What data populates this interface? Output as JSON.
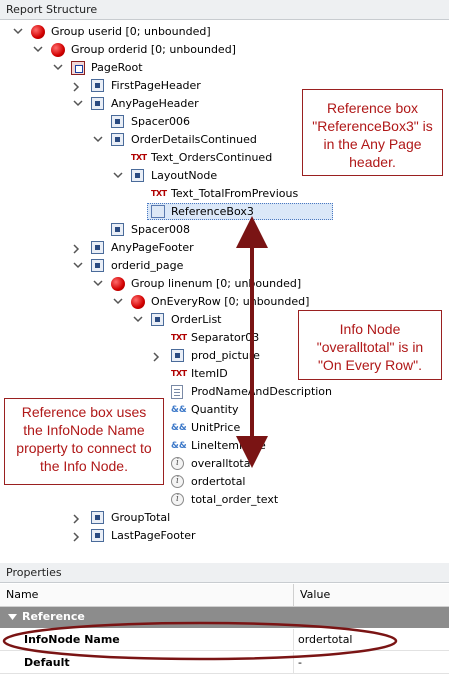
{
  "report_structure": {
    "title": "Report Structure",
    "nodes": [
      {
        "label": "Group userid [0; unbounded]",
        "icon": "group-icon",
        "expander": "expanded"
      },
      {
        "label": "Group orderid [0; unbounded]",
        "icon": "group-icon",
        "expander": "expanded"
      },
      {
        "label": "PageRoot",
        "icon": "page-root-icon",
        "expander": "expanded"
      },
      {
        "label": "FirstPageHeader",
        "icon": "container-icon",
        "expander": "collapsed"
      },
      {
        "label": "AnyPageHeader",
        "icon": "container-icon",
        "expander": "expanded"
      },
      {
        "label": "Spacer006",
        "icon": "spacer-icon",
        "expander": "none"
      },
      {
        "label": "OrderDetailsContinued",
        "icon": "container-icon",
        "expander": "expanded"
      },
      {
        "label": "Text_OrdersContinued",
        "icon": "text-icon",
        "icon_text": "TXT",
        "expander": "none"
      },
      {
        "label": "LayoutNode",
        "icon": "container-icon",
        "expander": "expanded"
      },
      {
        "label": "Text_TotalFromPrevious",
        "icon": "text-icon",
        "icon_text": "TXT",
        "expander": "none"
      },
      {
        "label": "ReferenceBox3",
        "icon": "reference-box-icon",
        "expander": "none",
        "selected": true
      },
      {
        "label": "Spacer008",
        "icon": "spacer-icon",
        "expander": "none"
      },
      {
        "label": "AnyPageFooter",
        "icon": "container-icon",
        "expander": "collapsed"
      },
      {
        "label": "orderid_page",
        "icon": "page-icon",
        "expander": "expanded"
      },
      {
        "label": "Group linenum [0; unbounded]",
        "icon": "group-icon",
        "expander": "expanded"
      },
      {
        "label": "OnEveryRow [0; unbounded]",
        "icon": "group-icon",
        "expander": "expanded"
      },
      {
        "label": "OrderList",
        "icon": "order-list-icon",
        "expander": "expanded"
      },
      {
        "label": "Separator03",
        "icon": "text-icon",
        "icon_text": "TXT",
        "expander": "none"
      },
      {
        "label": "prod_picture",
        "icon": "container-icon",
        "expander": "collapsed"
      },
      {
        "label": "ItemID",
        "icon": "text-icon",
        "icon_text": "TXT",
        "expander": "none"
      },
      {
        "label": "ProdNameAndDescription",
        "icon": "document-icon",
        "expander": "none"
      },
      {
        "label": "Quantity",
        "icon": "calc-icon",
        "icon_text": "&&",
        "expander": "none"
      },
      {
        "label": "UnitPrice",
        "icon": "calc-icon",
        "icon_text": "&&",
        "expander": "none"
      },
      {
        "label": "LineItemPrice",
        "icon": "calc-icon",
        "icon_text": "&&",
        "expander": "none"
      },
      {
        "label": "overalltotal",
        "icon": "info-node-icon",
        "icon_text": "i",
        "expander": "none"
      },
      {
        "label": "ordertotal",
        "icon": "info-node-icon",
        "icon_text": "i",
        "expander": "none"
      },
      {
        "label": "total_order_text",
        "icon": "info-node-icon",
        "icon_text": "i",
        "expander": "none"
      },
      {
        "label": "GroupTotal",
        "icon": "container-icon",
        "expander": "collapsed"
      },
      {
        "label": "LastPageFooter",
        "icon": "container-icon",
        "expander": "collapsed"
      }
    ]
  },
  "annotations": {
    "reference_box_note": "Reference box \"ReferenceBox3\" is in the Any Page header.",
    "info_node_note": "Info Node \"overalltotal\" is in \"On Every Row\".",
    "connection_note": "Reference box uses the InfoNode Name property to connect to the Info Node.",
    "arrow_color": "#7a1414",
    "callout_color": "#b01818"
  },
  "properties": {
    "title": "Properties",
    "columns": {
      "name": "Name",
      "value": "Value"
    },
    "category": "Reference",
    "rows": [
      {
        "name": "InfoNode Name",
        "value": "ordertotal",
        "highlighted": true
      },
      {
        "name": "Default",
        "value": "-"
      }
    ],
    "header_bg": "#8c8c8c"
  }
}
